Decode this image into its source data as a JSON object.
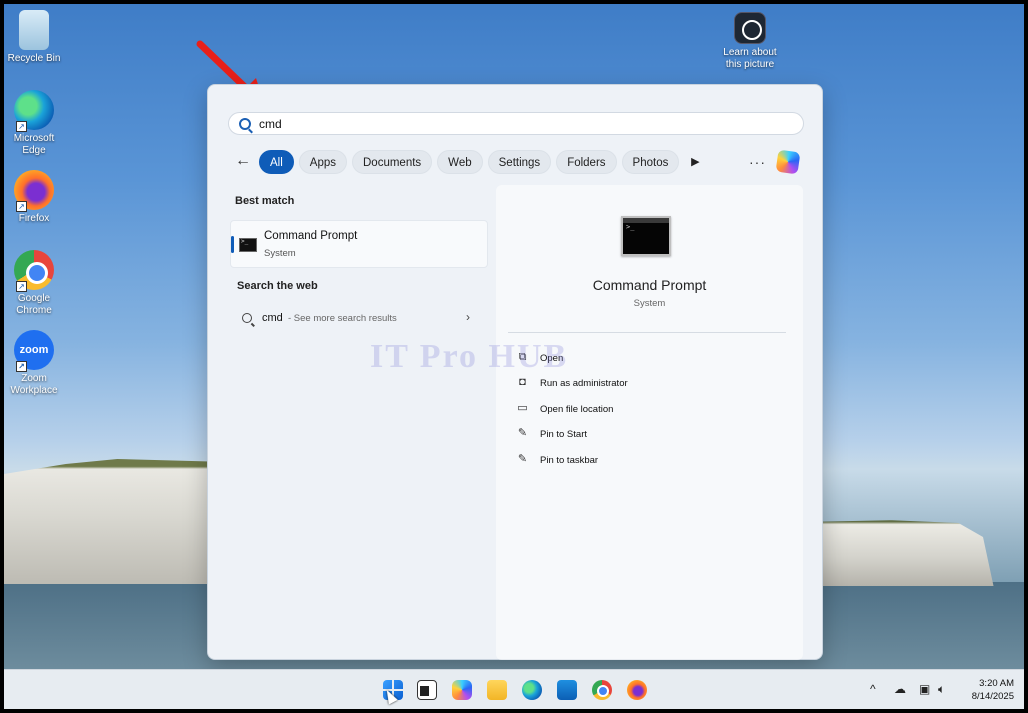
{
  "desktop": {
    "icons": [
      {
        "label": "Recycle Bin",
        "icon": "recycle-bin-icon"
      },
      {
        "label": "Microsoft Edge",
        "icon": "edge-icon"
      },
      {
        "label": "Firefox",
        "icon": "firefox-icon"
      },
      {
        "label": "Google Chrome",
        "icon": "chrome-icon"
      },
      {
        "label": "Zoom Workplace",
        "icon": "zoom-icon",
        "glyph": "zoom"
      }
    ],
    "learn_about_picture": "Learn about this picture"
  },
  "search": {
    "value": "cmd",
    "tabs": [
      "All",
      "Apps",
      "Documents",
      "Web",
      "Settings",
      "Folders",
      "Photos"
    ],
    "active_tab": "All",
    "best_match_title": "Best match",
    "best_match": {
      "name": "Command Prompt",
      "type": "System"
    },
    "web_title": "Search the web",
    "web_query": "cmd",
    "web_hint": "- See more search results"
  },
  "preview": {
    "name": "Command Prompt",
    "type": "System",
    "actions": [
      {
        "label": "Open",
        "icon": "open-external-icon"
      },
      {
        "label": "Run as administrator",
        "icon": "shield-admin-icon"
      },
      {
        "label": "Open file location",
        "icon": "folder-icon"
      },
      {
        "label": "Pin to Start",
        "icon": "pin-icon"
      },
      {
        "label": "Pin to taskbar",
        "icon": "pin-icon"
      }
    ]
  },
  "watermark": "IT Pro HUB",
  "taskbar": {
    "time": "3:20 AM",
    "date": "8/14/2025"
  },
  "colors": {
    "accent": "#0f5cb8",
    "annotation_arrow": "#e8201a"
  }
}
